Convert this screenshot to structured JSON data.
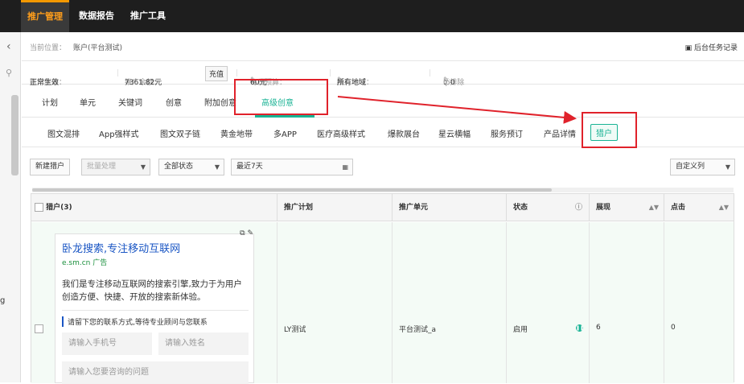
{
  "topbar": {
    "tabs": [
      "推广管理",
      "数据报告",
      "推广工具"
    ]
  },
  "breadcrumb": {
    "label": "当前位置：",
    "value": "账户(平台测试)",
    "tasks": "后台任务记录"
  },
  "status": {
    "state_label": "账户状态：",
    "state_value": "正常生效",
    "balance_label": "推广余额：",
    "balance_value": "7361.82元",
    "recharge": "充值",
    "budget_label": "每日预算：",
    "budget_value": "60元",
    "region_label": "推广地域：",
    "region_value": "所有地域",
    "ip_label": "ip排除",
    "ip_value": "：0"
  },
  "tabs1": [
    "计划",
    "单元",
    "关键词",
    "创意",
    "附加创意",
    "高级创意"
  ],
  "tabs2": [
    "图文混排",
    "App强样式",
    "图文双子链",
    "黄金地带",
    "多APP",
    "医疗高级样式",
    "爆款展台",
    "星云横幅",
    "服务预订",
    "产品详情",
    "猎户"
  ],
  "toolbar": {
    "new": "新建猎户",
    "batch": "批量处理",
    "state": "全部状态",
    "date": "最近7天",
    "custom": "自定义列"
  },
  "table": {
    "headers": [
      "猎户(3)",
      "推广计划",
      "推广单元",
      "状态",
      "展现",
      "点击"
    ],
    "row": {
      "plan": "LY测试",
      "unit": "平台测试_a",
      "status": "启用",
      "impressions": "6",
      "clicks": "0"
    }
  },
  "card": {
    "title": "卧龙搜索,专注移动互联网",
    "url": "e.sm.cn",
    "ad": "广告",
    "desc": "我们是专注移动互联网的搜索引擎,致力于为用户创造方便、快捷、开放的搜索新体验。",
    "prompt": "请留下您的联系方式,等待专业顾问与您联系",
    "phone": "请输入手机号",
    "name": "请输入姓名",
    "question": "请输入您要咨询的问题"
  },
  "colors": {
    "accent": "#19b394",
    "orange": "#f39800",
    "annotation": "#e0222b"
  }
}
